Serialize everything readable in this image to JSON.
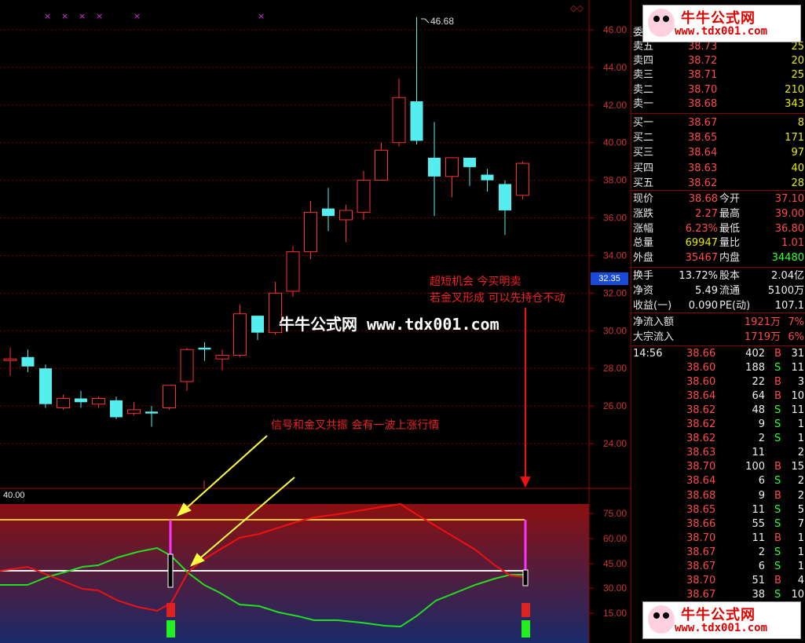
{
  "chart": {
    "price_axis": [
      "46.00",
      "44.00",
      "42.00",
      "40.00",
      "38.00",
      "36.00",
      "34.00",
      "32.00",
      "30.00",
      "28.00",
      "26.00",
      "24.00"
    ],
    "current_price_tag": "32.35",
    "high_marker": "46.68",
    "indicator_value": "40.00",
    "indicator_axis": [
      "75.00",
      "60.00",
      "45.00",
      "30.00",
      "15.00"
    ],
    "annotation_top_line1": "超短机会  今买明卖",
    "annotation_top_line2": "若金叉形成 可以先持仓不动",
    "annotation_bottom": "信号和金叉共振 会有一波上涨行情",
    "watermark": "牛牛公式网 www.tdx001.com",
    "colors": {
      "up": "#ff3030",
      "down": "#55eeee",
      "grid": "#7a0000"
    },
    "candles": [
      {
        "o": 28.5,
        "c": 28.5,
        "h": 29.1,
        "l": 27.6,
        "dir": "up"
      },
      {
        "o": 28.6,
        "c": 28.1,
        "h": 29.0,
        "l": 27.8,
        "dir": "down"
      },
      {
        "o": 28.0,
        "c": 26.1,
        "h": 28.2,
        "l": 25.9,
        "dir": "down"
      },
      {
        "o": 25.9,
        "c": 26.4,
        "h": 26.6,
        "l": 25.8,
        "dir": "up"
      },
      {
        "o": 26.4,
        "c": 26.2,
        "h": 26.8,
        "l": 25.9,
        "dir": "down"
      },
      {
        "o": 26.1,
        "c": 26.4,
        "h": 26.5,
        "l": 25.9,
        "dir": "up"
      },
      {
        "o": 26.3,
        "c": 25.4,
        "h": 26.5,
        "l": 25.3,
        "dir": "down"
      },
      {
        "o": 25.6,
        "c": 25.8,
        "h": 26.2,
        "l": 25.5,
        "dir": "up"
      },
      {
        "o": 25.7,
        "c": 25.6,
        "h": 26.0,
        "l": 24.9,
        "dir": "down"
      },
      {
        "o": 25.9,
        "c": 27.1,
        "h": 27.1,
        "l": 25.8,
        "dir": "up"
      },
      {
        "o": 27.3,
        "c": 29.0,
        "h": 29.1,
        "l": 26.8,
        "dir": "up"
      },
      {
        "o": 29.1,
        "c": 29.0,
        "h": 29.4,
        "l": 28.4,
        "dir": "down"
      },
      {
        "o": 28.5,
        "c": 28.7,
        "h": 29.0,
        "l": 27.9,
        "dir": "up"
      },
      {
        "o": 28.7,
        "c": 30.9,
        "h": 31.4,
        "l": 28.6,
        "dir": "up"
      },
      {
        "o": 30.8,
        "c": 29.9,
        "h": 30.8,
        "l": 29.5,
        "dir": "down"
      },
      {
        "o": 29.9,
        "c": 32.0,
        "h": 32.6,
        "l": 29.8,
        "dir": "up"
      },
      {
        "o": 32.1,
        "c": 34.2,
        "h": 34.5,
        "l": 31.8,
        "dir": "up"
      },
      {
        "o": 34.2,
        "c": 36.3,
        "h": 36.9,
        "l": 33.8,
        "dir": "up"
      },
      {
        "o": 36.5,
        "c": 36.1,
        "h": 37.6,
        "l": 35.3,
        "dir": "down"
      },
      {
        "o": 35.9,
        "c": 36.4,
        "h": 36.7,
        "l": 34.7,
        "dir": "up"
      },
      {
        "o": 36.3,
        "c": 38.0,
        "h": 38.5,
        "l": 35.9,
        "dir": "up"
      },
      {
        "o": 38.0,
        "c": 39.6,
        "h": 40.0,
        "l": 38.0,
        "dir": "up"
      },
      {
        "o": 40.0,
        "c": 42.4,
        "h": 43.4,
        "l": 39.8,
        "dir": "up"
      },
      {
        "o": 42.2,
        "c": 40.1,
        "h": 46.68,
        "l": 39.9,
        "dir": "down"
      },
      {
        "o": 39.2,
        "c": 38.2,
        "h": 41.1,
        "l": 36.1,
        "dir": "down"
      },
      {
        "o": 38.2,
        "c": 39.2,
        "h": 39.2,
        "l": 37.1,
        "dir": "up"
      },
      {
        "o": 39.2,
        "c": 38.7,
        "h": 39.2,
        "l": 37.7,
        "dir": "down"
      },
      {
        "o": 38.3,
        "c": 38.0,
        "h": 38.6,
        "l": 37.4,
        "dir": "down"
      },
      {
        "o": 37.8,
        "c": 36.4,
        "h": 38.0,
        "l": 35.1,
        "dir": "down"
      },
      {
        "o": 37.2,
        "c": 38.9,
        "h": 39.0,
        "l": 37.0,
        "dir": "up"
      }
    ]
  },
  "quote": {
    "sell_header": "委",
    "asks": [
      {
        "label": "卖五",
        "price": "38.73",
        "vol": "25"
      },
      {
        "label": "卖四",
        "price": "38.72",
        "vol": "20"
      },
      {
        "label": "卖三",
        "price": "38.71",
        "vol": "25"
      },
      {
        "label": "卖二",
        "price": "38.70",
        "vol": "210"
      },
      {
        "label": "卖一",
        "price": "38.68",
        "vol": "343"
      }
    ],
    "bids": [
      {
        "label": "买一",
        "price": "38.67",
        "vol": "8"
      },
      {
        "label": "买二",
        "price": "38.65",
        "vol": "171"
      },
      {
        "label": "买三",
        "price": "38.64",
        "vol": "97"
      },
      {
        "label": "买四",
        "price": "38.63",
        "vol": "40"
      },
      {
        "label": "买五",
        "price": "38.62",
        "vol": "28"
      }
    ],
    "stats": [
      {
        "l1": "现价",
        "v1": "38.68",
        "l2": "今开",
        "v2": "37.10",
        "c1": "red",
        "c2": "red"
      },
      {
        "l1": "涨跌",
        "v1": "2.27",
        "l2": "最高",
        "v2": "39.00",
        "c1": "red",
        "c2": "red"
      },
      {
        "l1": "涨幅",
        "v1": "6.23%",
        "l2": "最低",
        "v2": "36.80",
        "c1": "red",
        "c2": "red"
      },
      {
        "l1": "总量",
        "v1": "69947",
        "l2": "量比",
        "v2": "1.01",
        "c1": "yel",
        "c2": "red"
      },
      {
        "l1": "外盘",
        "v1": "35467",
        "l2": "内盘",
        "v2": "34480",
        "c1": "red",
        "c2": "green"
      }
    ],
    "stats2": [
      {
        "l1": "换手",
        "v1": "13.72%",
        "l2": "股本",
        "v2": "2.04亿"
      },
      {
        "l1": "净资",
        "v1": "5.49",
        "l2": "流通",
        "v2": "5100万"
      },
      {
        "l1": "收益(一)",
        "v1": "0.090",
        "l2": "PE(动)",
        "v2": "107.1"
      }
    ],
    "flows": [
      {
        "label": "净流入额",
        "v": "1921万",
        "p": "7%"
      },
      {
        "label": "大宗流入",
        "v": "1719万",
        "p": "6%"
      }
    ],
    "ticks_time": "14:56",
    "ticks": [
      {
        "p": "38.66",
        "v": "402",
        "s": "B",
        "n": "31"
      },
      {
        "p": "38.60",
        "v": "188",
        "s": "S",
        "n": "11"
      },
      {
        "p": "38.60",
        "v": "22",
        "s": "B",
        "n": "3"
      },
      {
        "p": "38.64",
        "v": "64",
        "s": "B",
        "n": "10"
      },
      {
        "p": "38.62",
        "v": "48",
        "s": "S",
        "n": "11"
      },
      {
        "p": "38.62",
        "v": "9",
        "s": "S",
        "n": "1"
      },
      {
        "p": "38.62",
        "v": "2",
        "s": "S",
        "n": "1"
      },
      {
        "p": "38.63",
        "v": "11",
        "s": "",
        "n": "2"
      },
      {
        "p": "38.70",
        "v": "100",
        "s": "B",
        "n": "15"
      },
      {
        "p": "38.64",
        "v": "6",
        "s": "S",
        "n": "2"
      },
      {
        "p": "38.68",
        "v": "9",
        "s": "B",
        "n": "2"
      },
      {
        "p": "38.65",
        "v": "11",
        "s": "S",
        "n": "5"
      },
      {
        "p": "38.66",
        "v": "55",
        "s": "S",
        "n": "7"
      },
      {
        "p": "38.70",
        "v": "11",
        "s": "B",
        "n": "1"
      },
      {
        "p": "38.67",
        "v": "2",
        "s": "S",
        "n": "1"
      },
      {
        "p": "38.67",
        "v": "6",
        "s": "S",
        "n": "1"
      },
      {
        "p": "38.70",
        "v": "51",
        "s": "B",
        "n": "4"
      },
      {
        "p": "38.67",
        "v": "38",
        "s": "S",
        "n": "10"
      }
    ],
    "logo_title": "牛牛公式网",
    "logo_url": "www.tdx001.com"
  },
  "chart_data": {
    "type": "candlestick",
    "price_range": [
      22.5,
      47.5
    ],
    "indicator_range": [
      0,
      90
    ]
  }
}
